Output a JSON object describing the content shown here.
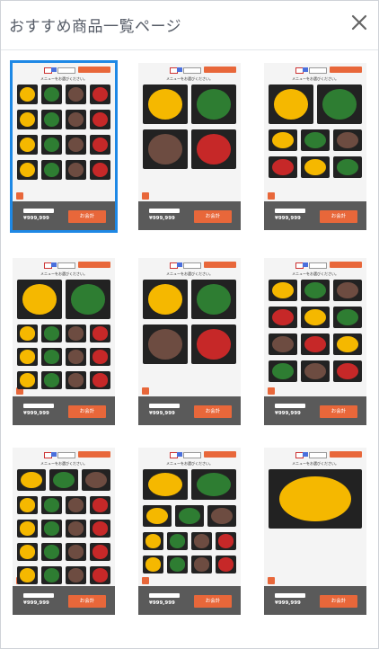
{
  "dialog": {
    "title": "おすすめ商品一覧ページ",
    "close_label": "×"
  },
  "thumbnail_common": {
    "prompt": "メニューをお選びください。",
    "pay_label": "お会計",
    "price": "¥999,999"
  },
  "layouts": [
    {
      "id": 1,
      "selected": true,
      "pattern": "4col"
    },
    {
      "id": 2,
      "selected": false,
      "pattern": "2col-large"
    },
    {
      "id": 3,
      "selected": false,
      "pattern": "2-then-3col"
    },
    {
      "id": 4,
      "selected": false,
      "pattern": "2large-then-4col"
    },
    {
      "id": 5,
      "selected": false,
      "pattern": "2large-then-2large"
    },
    {
      "id": 6,
      "selected": false,
      "pattern": "3col"
    },
    {
      "id": 7,
      "selected": false,
      "pattern": "3-then-4col"
    },
    {
      "id": 8,
      "selected": false,
      "pattern": "2-then-3-then-4"
    },
    {
      "id": 9,
      "selected": false,
      "pattern": "1col-xl"
    }
  ],
  "colors": {
    "accent": "#e8673a",
    "selected": "#1e88e5",
    "footer": "#5a5a5a"
  }
}
